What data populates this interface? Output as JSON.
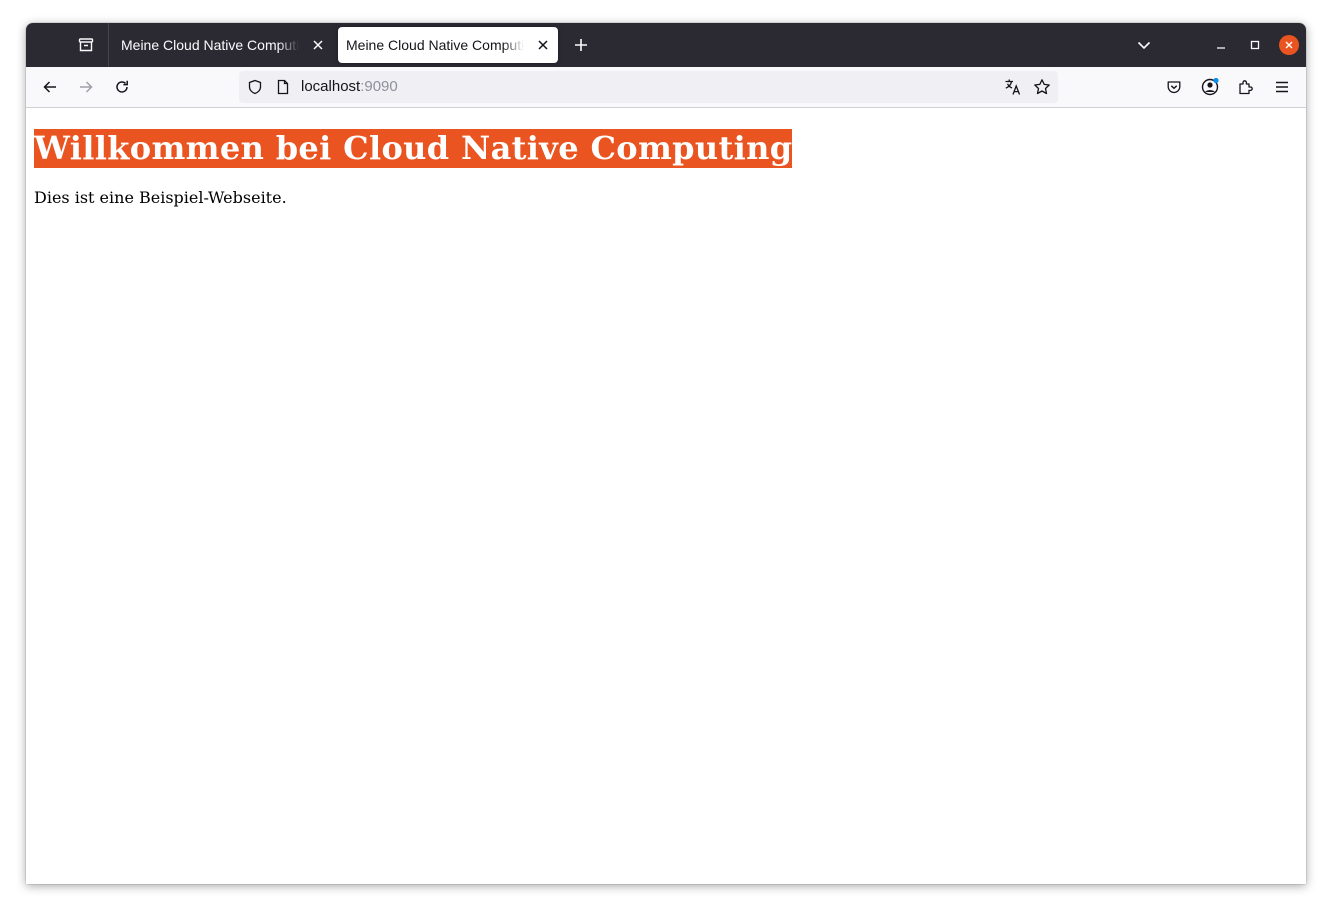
{
  "browser": {
    "tabs": [
      {
        "title": "Meine Cloud Native Computing",
        "active": false
      },
      {
        "title": "Meine Cloud Native Computing",
        "active": true
      }
    ],
    "url": {
      "host": "localhost",
      "port": ":9090"
    }
  },
  "page": {
    "heading": "Willkommen bei Cloud Native Computing",
    "paragraph": "Dies ist eine Beispiel-Webseite."
  },
  "colors": {
    "accent": "#e95420",
    "tabbar": "#2b2a33",
    "toolbar": "#f9f9fb",
    "notification_dot": "#0090ed"
  },
  "icons": {
    "tab_manager": "tab-manager-icon",
    "close": "close-icon",
    "new_tab": "plus-icon",
    "list_tabs": "chevron-down-icon",
    "back": "arrow-left-icon",
    "forward": "arrow-right-icon",
    "reload": "reload-icon",
    "tracking": "shield-icon",
    "page_info": "page-icon",
    "translate": "translate-icon",
    "bookmark": "star-icon",
    "pocket": "pocket-icon",
    "account": "account-icon",
    "extensions": "puzzle-icon",
    "menu": "hamburger-menu-icon"
  }
}
